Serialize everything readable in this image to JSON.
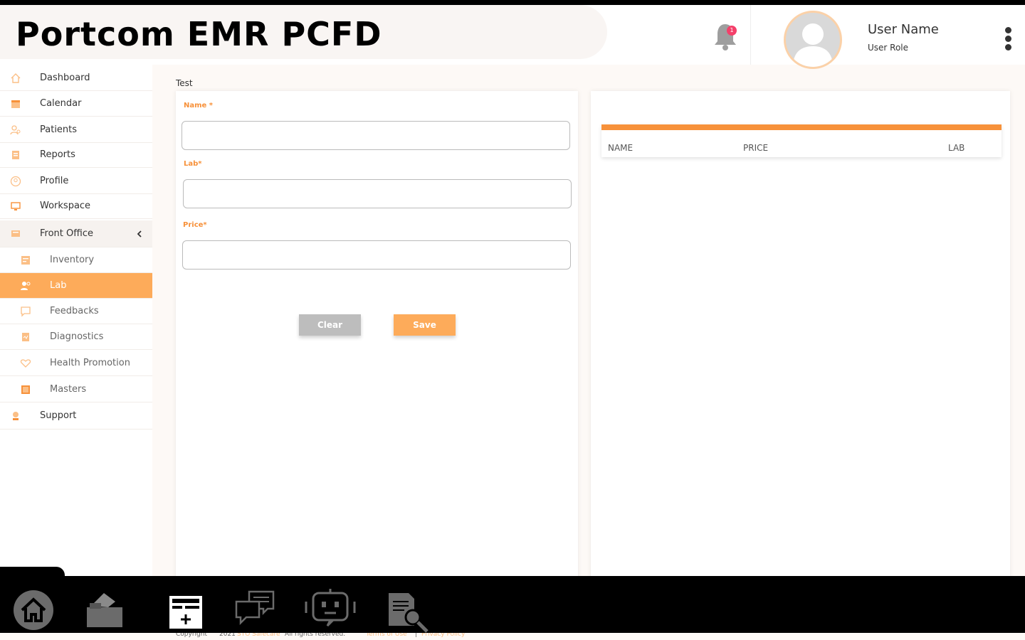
{
  "app": {
    "title": "Portcom EMR PCFD"
  },
  "header": {
    "notification_count": "1",
    "user_name": "User Name",
    "user_role": "User Role"
  },
  "sidebar": {
    "items": [
      {
        "label": "Dashboard",
        "icon": "home-icon"
      },
      {
        "label": "Calendar",
        "icon": "calendar-icon"
      },
      {
        "label": "Patients",
        "icon": "patients-icon"
      },
      {
        "label": "Reports",
        "icon": "reports-icon"
      },
      {
        "label": "Profile",
        "icon": "profile-icon"
      },
      {
        "label": "Workspace",
        "icon": "workspace-icon"
      },
      {
        "label": "Front Office",
        "icon": "front-office-icon"
      },
      {
        "label": "Inventory",
        "icon": "inventory-icon"
      },
      {
        "label": "Lab",
        "icon": "lab-icon"
      },
      {
        "label": "Feedbacks",
        "icon": "feedbacks-icon"
      },
      {
        "label": "Diagnostics",
        "icon": "diagnostics-icon"
      },
      {
        "label": "Health Promotion",
        "icon": "health-promotion-icon"
      },
      {
        "label": "Masters",
        "icon": "masters-icon"
      },
      {
        "label": "Support",
        "icon": "support-icon"
      }
    ],
    "active": "Lab"
  },
  "page": {
    "breadcrumb": "Test",
    "form": {
      "name_label": "Name *",
      "name_value": "",
      "lab_label": "Lab*",
      "lab_value": "",
      "price_label": "Price*",
      "price_value": "",
      "clear_label": "Clear",
      "save_label": "Save"
    },
    "table": {
      "columns": [
        "NAME",
        "PRICE",
        "LAB"
      ],
      "rows": []
    }
  },
  "footer": {
    "copyright": "Copyright",
    "year_text": "2021",
    "company": "STO Safecare",
    "rights": "All rights reserved.",
    "terms": "Terms of Use",
    "separator": "|",
    "privacy": "Privacy Policy"
  },
  "colors": {
    "accent": "#f7913a",
    "active_item": "#fdab5a",
    "clear_button": "#bdbdbd",
    "badge": "#f4406a"
  },
  "bottom_bar": {
    "icons": [
      "home-icon",
      "folder-icon",
      "medical-card-icon",
      "chat-icon",
      "chatbot-icon",
      "document-search-icon"
    ]
  }
}
